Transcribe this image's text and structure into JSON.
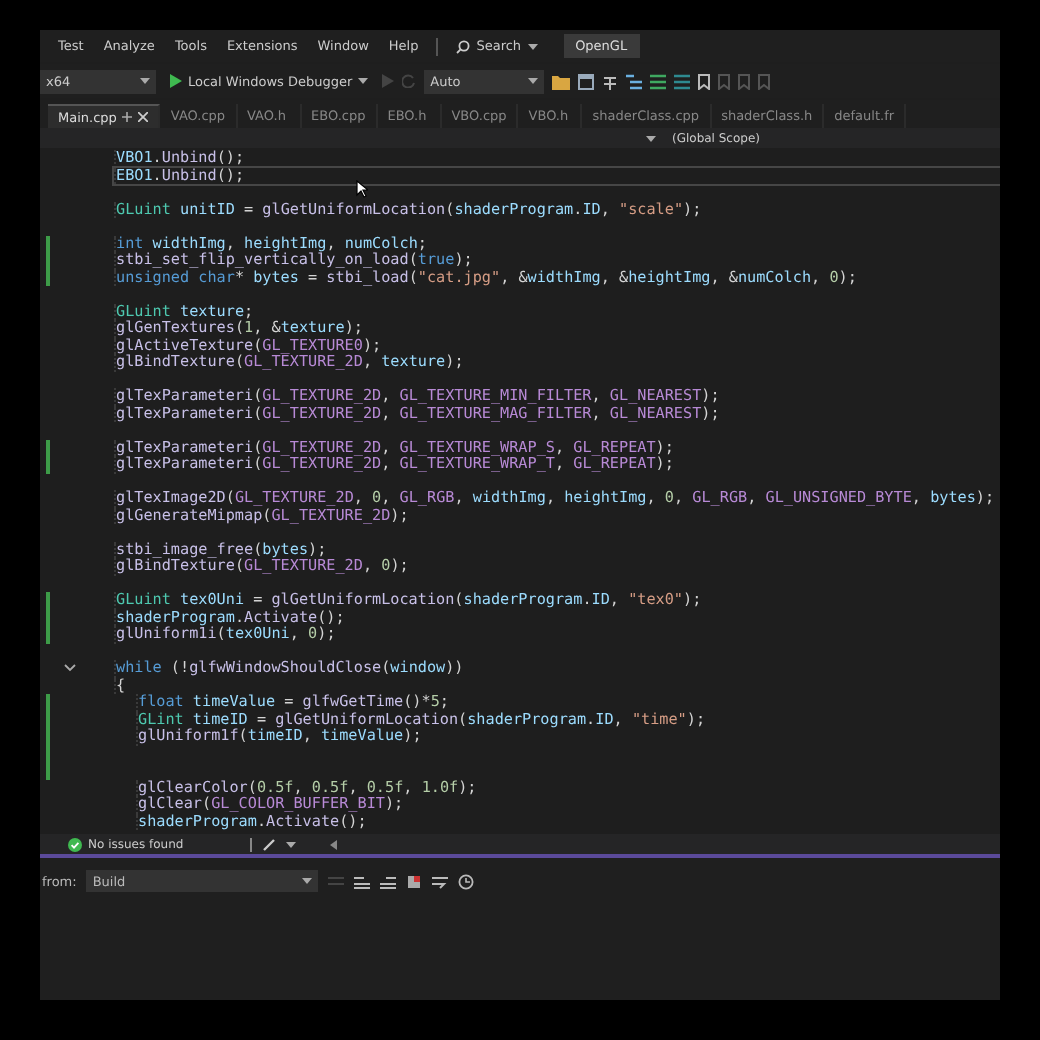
{
  "menu": [
    "Test",
    "Analyze",
    "Tools",
    "Extensions",
    "Window",
    "Help"
  ],
  "search": {
    "label": "Search"
  },
  "solution_title": "OpenGL",
  "toolbar": {
    "platform": "x64",
    "debugger": "Local Windows Debugger",
    "config": "Auto"
  },
  "tabs": [
    {
      "label": "Main.cpp",
      "selected": true
    },
    {
      "label": "VAO.cpp",
      "selected": false
    },
    {
      "label": "VAO.h",
      "selected": false
    },
    {
      "label": "EBO.cpp",
      "selected": false
    },
    {
      "label": "EBO.h",
      "selected": false
    },
    {
      "label": "VBO.cpp",
      "selected": false
    },
    {
      "label": "VBO.h",
      "selected": false
    },
    {
      "label": "shaderClass.cpp",
      "selected": false
    },
    {
      "label": "shaderClass.h",
      "selected": false
    },
    {
      "label": "default.fr",
      "selected": false
    }
  ],
  "scope": "(Global Scope)",
  "code": [
    {
      "changed": false,
      "current": false,
      "foldable": false,
      "tokens": [
        {
          "kind": "var",
          "text": "VBO1"
        },
        {
          "kind": "plain",
          "text": "."
        },
        {
          "kind": "fn",
          "text": "Unbind"
        },
        {
          "kind": "plain",
          "text": "();"
        }
      ]
    },
    {
      "changed": false,
      "current": true,
      "foldable": false,
      "tokens": [
        {
          "kind": "var",
          "text": "EBO1"
        },
        {
          "kind": "plain",
          "text": "."
        },
        {
          "kind": "fn",
          "text": "Unbind"
        },
        {
          "kind": "plain",
          "text": "();"
        }
      ]
    },
    {
      "changed": false,
      "current": false,
      "foldable": false
    },
    {
      "changed": false,
      "current": false,
      "foldable": false,
      "tokens": [
        {
          "kind": "type",
          "text": "GLuint"
        },
        {
          "kind": "var",
          "text": " unitID"
        },
        {
          "kind": "plain",
          "text": " = "
        },
        {
          "kind": "fn",
          "text": "glGetUniformLocation"
        },
        {
          "kind": "plain",
          "text": "("
        },
        {
          "kind": "var",
          "text": "shaderProgram"
        },
        {
          "kind": "plain",
          "text": "."
        },
        {
          "kind": "var",
          "text": "ID"
        },
        {
          "kind": "plain",
          "text": ", "
        },
        {
          "kind": "str",
          "text": "\"scale\""
        },
        {
          "kind": "plain",
          "text": ");"
        }
      ]
    },
    {
      "changed": false,
      "current": false,
      "foldable": false
    },
    {
      "changed": true,
      "current": false,
      "foldable": false,
      "tokens": [
        {
          "kind": "kw",
          "text": "int"
        },
        {
          "kind": "var",
          "text": " widthImg"
        },
        {
          "kind": "plain",
          "text": ", "
        },
        {
          "kind": "var",
          "text": "heightImg"
        },
        {
          "kind": "plain",
          "text": ", "
        },
        {
          "kind": "var",
          "text": "numColch"
        },
        {
          "kind": "plain",
          "text": ";"
        }
      ]
    },
    {
      "changed": true,
      "current": false,
      "foldable": false,
      "tokens": [
        {
          "kind": "fn",
          "text": "stbi_set_flip_vertically_on_load"
        },
        {
          "kind": "plain",
          "text": "("
        },
        {
          "kind": "kw",
          "text": "true"
        },
        {
          "kind": "plain",
          "text": ");"
        }
      ]
    },
    {
      "changed": true,
      "current": false,
      "foldable": false,
      "tokens": [
        {
          "kind": "kw",
          "text": "unsigned char"
        },
        {
          "kind": "plain",
          "text": "* "
        },
        {
          "kind": "var",
          "text": "bytes"
        },
        {
          "kind": "plain",
          "text": " = "
        },
        {
          "kind": "fn",
          "text": "stbi_load"
        },
        {
          "kind": "plain",
          "text": "("
        },
        {
          "kind": "str",
          "text": "\"cat.jpg\""
        },
        {
          "kind": "plain",
          "text": ", &"
        },
        {
          "kind": "var",
          "text": "widthImg"
        },
        {
          "kind": "plain",
          "text": ", &"
        },
        {
          "kind": "var",
          "text": "heightImg"
        },
        {
          "kind": "plain",
          "text": ", &"
        },
        {
          "kind": "var",
          "text": "numColch"
        },
        {
          "kind": "plain",
          "text": ", "
        },
        {
          "kind": "num",
          "text": "0"
        },
        {
          "kind": "plain",
          "text": ");"
        }
      ]
    },
    {
      "changed": false,
      "current": false,
      "foldable": false
    },
    {
      "changed": false,
      "current": false,
      "foldable": false,
      "tokens": [
        {
          "kind": "type",
          "text": "GLuint"
        },
        {
          "kind": "var",
          "text": " texture"
        },
        {
          "kind": "plain",
          "text": ";"
        }
      ]
    },
    {
      "changed": false,
      "current": false,
      "foldable": false,
      "tokens": [
        {
          "kind": "fn",
          "text": "glGenTextures"
        },
        {
          "kind": "plain",
          "text": "("
        },
        {
          "kind": "num",
          "text": "1"
        },
        {
          "kind": "plain",
          "text": ", &"
        },
        {
          "kind": "var",
          "text": "texture"
        },
        {
          "kind": "plain",
          "text": ");"
        }
      ]
    },
    {
      "changed": false,
      "current": false,
      "foldable": false,
      "tokens": [
        {
          "kind": "fn",
          "text": "glActiveTexture"
        },
        {
          "kind": "plain",
          "text": "("
        },
        {
          "kind": "macro",
          "text": "GL_TEXTURE0"
        },
        {
          "kind": "plain",
          "text": ");"
        }
      ]
    },
    {
      "changed": false,
      "current": false,
      "foldable": false,
      "tokens": [
        {
          "kind": "fn",
          "text": "glBindTexture"
        },
        {
          "kind": "plain",
          "text": "("
        },
        {
          "kind": "macro",
          "text": "GL_TEXTURE_2D"
        },
        {
          "kind": "plain",
          "text": ", "
        },
        {
          "kind": "var",
          "text": "texture"
        },
        {
          "kind": "plain",
          "text": ");"
        }
      ]
    },
    {
      "changed": false,
      "current": false,
      "foldable": false
    },
    {
      "changed": false,
      "current": false,
      "foldable": false,
      "tokens": [
        {
          "kind": "fn",
          "text": "glTexParameteri"
        },
        {
          "kind": "plain",
          "text": "("
        },
        {
          "kind": "macro",
          "text": "GL_TEXTURE_2D"
        },
        {
          "kind": "plain",
          "text": ", "
        },
        {
          "kind": "macro",
          "text": "GL_TEXTURE_MIN_FILTER"
        },
        {
          "kind": "plain",
          "text": ", "
        },
        {
          "kind": "macro",
          "text": "GL_NEAREST"
        },
        {
          "kind": "plain",
          "text": ");"
        }
      ]
    },
    {
      "changed": false,
      "current": false,
      "foldable": false,
      "tokens": [
        {
          "kind": "fn",
          "text": "glTexParameteri"
        },
        {
          "kind": "plain",
          "text": "("
        },
        {
          "kind": "macro",
          "text": "GL_TEXTURE_2D"
        },
        {
          "kind": "plain",
          "text": ", "
        },
        {
          "kind": "macro",
          "text": "GL_TEXTURE_MAG_FILTER"
        },
        {
          "kind": "plain",
          "text": ", "
        },
        {
          "kind": "macro",
          "text": "GL_NEAREST"
        },
        {
          "kind": "plain",
          "text": ");"
        }
      ]
    },
    {
      "changed": false,
      "current": false,
      "foldable": false
    },
    {
      "changed": true,
      "current": false,
      "foldable": false,
      "tokens": [
        {
          "kind": "fn",
          "text": "glTexParameteri"
        },
        {
          "kind": "plain",
          "text": "("
        },
        {
          "kind": "macro",
          "text": "GL_TEXTURE_2D"
        },
        {
          "kind": "plain",
          "text": ", "
        },
        {
          "kind": "macro",
          "text": "GL_TEXTURE_WRAP_S"
        },
        {
          "kind": "plain",
          "text": ", "
        },
        {
          "kind": "macro",
          "text": "GL_REPEAT"
        },
        {
          "kind": "plain",
          "text": ");"
        }
      ]
    },
    {
      "changed": true,
      "current": false,
      "foldable": false,
      "tokens": [
        {
          "kind": "fn",
          "text": "glTexParameteri"
        },
        {
          "kind": "plain",
          "text": "("
        },
        {
          "kind": "macro",
          "text": "GL_TEXTURE_2D"
        },
        {
          "kind": "plain",
          "text": ", "
        },
        {
          "kind": "macro",
          "text": "GL_TEXTURE_WRAP_T"
        },
        {
          "kind": "plain",
          "text": ", "
        },
        {
          "kind": "macro",
          "text": "GL_REPEAT"
        },
        {
          "kind": "plain",
          "text": ");"
        }
      ]
    },
    {
      "changed": false,
      "current": false,
      "foldable": false
    },
    {
      "changed": false,
      "current": false,
      "foldable": false,
      "tokens": [
        {
          "kind": "fn",
          "text": "glTexImage2D"
        },
        {
          "kind": "plain",
          "text": "("
        },
        {
          "kind": "macro",
          "text": "GL_TEXTURE_2D"
        },
        {
          "kind": "plain",
          "text": ", "
        },
        {
          "kind": "num",
          "text": "0"
        },
        {
          "kind": "plain",
          "text": ", "
        },
        {
          "kind": "macro",
          "text": "GL_RGB"
        },
        {
          "kind": "plain",
          "text": ", "
        },
        {
          "kind": "var",
          "text": "widthImg"
        },
        {
          "kind": "plain",
          "text": ", "
        },
        {
          "kind": "var",
          "text": "heightImg"
        },
        {
          "kind": "plain",
          "text": ", "
        },
        {
          "kind": "num",
          "text": "0"
        },
        {
          "kind": "plain",
          "text": ", "
        },
        {
          "kind": "macro",
          "text": "GL_RGB"
        },
        {
          "kind": "plain",
          "text": ", "
        },
        {
          "kind": "macro",
          "text": "GL_UNSIGNED_BYTE"
        },
        {
          "kind": "plain",
          "text": ", "
        },
        {
          "kind": "var",
          "text": "bytes"
        },
        {
          "kind": "plain",
          "text": ");"
        }
      ]
    },
    {
      "changed": false,
      "current": false,
      "foldable": false,
      "tokens": [
        {
          "kind": "fn",
          "text": "glGenerateMipmap"
        },
        {
          "kind": "plain",
          "text": "("
        },
        {
          "kind": "macro",
          "text": "GL_TEXTURE_2D"
        },
        {
          "kind": "plain",
          "text": ");"
        }
      ]
    },
    {
      "changed": false,
      "current": false,
      "foldable": false
    },
    {
      "changed": false,
      "current": false,
      "foldable": false,
      "tokens": [
        {
          "kind": "fn",
          "text": "stbi_image_free"
        },
        {
          "kind": "plain",
          "text": "("
        },
        {
          "kind": "var",
          "text": "bytes"
        },
        {
          "kind": "plain",
          "text": ");"
        }
      ]
    },
    {
      "changed": false,
      "current": false,
      "foldable": false,
      "tokens": [
        {
          "kind": "fn",
          "text": "glBindTexture"
        },
        {
          "kind": "plain",
          "text": "("
        },
        {
          "kind": "macro",
          "text": "GL_TEXTURE_2D"
        },
        {
          "kind": "plain",
          "text": ", "
        },
        {
          "kind": "num",
          "text": "0"
        },
        {
          "kind": "plain",
          "text": ");"
        }
      ]
    },
    {
      "changed": false,
      "current": false,
      "foldable": false
    },
    {
      "changed": true,
      "current": false,
      "foldable": false,
      "tokens": [
        {
          "kind": "type",
          "text": "GLuint"
        },
        {
          "kind": "var",
          "text": " tex0Uni"
        },
        {
          "kind": "plain",
          "text": " = "
        },
        {
          "kind": "fn",
          "text": "glGetUniformLocation"
        },
        {
          "kind": "plain",
          "text": "("
        },
        {
          "kind": "var",
          "text": "shaderProgram"
        },
        {
          "kind": "plain",
          "text": "."
        },
        {
          "kind": "var",
          "text": "ID"
        },
        {
          "kind": "plain",
          "text": ", "
        },
        {
          "kind": "str",
          "text": "\"tex0\""
        },
        {
          "kind": "plain",
          "text": ");"
        }
      ]
    },
    {
      "changed": true,
      "current": false,
      "foldable": false,
      "tokens": [
        {
          "kind": "var",
          "text": "shaderProgram"
        },
        {
          "kind": "plain",
          "text": "."
        },
        {
          "kind": "fn",
          "text": "Activate"
        },
        {
          "kind": "plain",
          "text": "();"
        }
      ]
    },
    {
      "changed": true,
      "current": false,
      "foldable": false,
      "tokens": [
        {
          "kind": "fn",
          "text": "glUniform1i"
        },
        {
          "kind": "plain",
          "text": "("
        },
        {
          "kind": "var",
          "text": "tex0Uni"
        },
        {
          "kind": "plain",
          "text": ", "
        },
        {
          "kind": "num",
          "text": "0"
        },
        {
          "kind": "plain",
          "text": ");"
        }
      ]
    },
    {
      "changed": false,
      "current": false,
      "foldable": false
    },
    {
      "changed": false,
      "current": false,
      "foldable": true,
      "tokens": [
        {
          "kind": "kw",
          "text": "while"
        },
        {
          "kind": "plain",
          "text": " (!"
        },
        {
          "kind": "fn",
          "text": "glfwWindowShouldClose"
        },
        {
          "kind": "plain",
          "text": "("
        },
        {
          "kind": "var",
          "text": "window"
        },
        {
          "kind": "plain",
          "text": "))"
        }
      ]
    },
    {
      "changed": false,
      "current": false,
      "foldable": false,
      "tokens": [
        {
          "kind": "plain",
          "text": "{"
        }
      ],
      "children": [
        {
          "changed": true,
          "current": false,
          "foldable": false,
          "tokens": [
            {
              "kind": "kw",
              "text": "float"
            },
            {
              "kind": "var",
              "text": " timeValue"
            },
            {
              "kind": "plain",
              "text": " = "
            },
            {
              "kind": "fn",
              "text": "glfwGetTime"
            },
            {
              "kind": "plain",
              "text": "()*"
            },
            {
              "kind": "num",
              "text": "5"
            },
            {
              "kind": "plain",
              "text": ";"
            }
          ]
        },
        {
          "changed": true,
          "current": false,
          "foldable": false,
          "tokens": [
            {
              "kind": "type",
              "text": "GLint"
            },
            {
              "kind": "var",
              "text": " timeID"
            },
            {
              "kind": "plain",
              "text": " = "
            },
            {
              "kind": "fn",
              "text": "glGetUniformLocation"
            },
            {
              "kind": "plain",
              "text": "("
            },
            {
              "kind": "var",
              "text": "shaderProgram"
            },
            {
              "kind": "plain",
              "text": "."
            },
            {
              "kind": "var",
              "text": "ID"
            },
            {
              "kind": "plain",
              "text": ", "
            },
            {
              "kind": "str",
              "text": "\"time\""
            },
            {
              "kind": "plain",
              "text": ");"
            }
          ]
        },
        {
          "changed": true,
          "current": false,
          "foldable": false,
          "tokens": [
            {
              "kind": "fn",
              "text": "glUniform1f"
            },
            {
              "kind": "plain",
              "text": "("
            },
            {
              "kind": "var",
              "text": "timeID"
            },
            {
              "kind": "plain",
              "text": ", "
            },
            {
              "kind": "var",
              "text": "timeValue"
            },
            {
              "kind": "plain",
              "text": ");"
            }
          ]
        },
        {
          "changed": true,
          "current": false,
          "foldable": false
        },
        {
          "changed": true,
          "current": false,
          "foldable": false
        },
        {
          "changed": false,
          "current": false,
          "foldable": false,
          "tokens": [
            {
              "kind": "fn",
              "text": "glClearColor"
            },
            {
              "kind": "plain",
              "text": "("
            },
            {
              "kind": "num",
              "text": "0.5f"
            },
            {
              "kind": "plain",
              "text": ", "
            },
            {
              "kind": "num",
              "text": "0.5f"
            },
            {
              "kind": "plain",
              "text": ", "
            },
            {
              "kind": "num",
              "text": "0.5f"
            },
            {
              "kind": "plain",
              "text": ", "
            },
            {
              "kind": "num",
              "text": "1.0f"
            },
            {
              "kind": "plain",
              "text": ");"
            }
          ]
        },
        {
          "changed": false,
          "current": false,
          "foldable": false,
          "tokens": [
            {
              "kind": "fn",
              "text": "glClear"
            },
            {
              "kind": "plain",
              "text": "("
            },
            {
              "kind": "macro",
              "text": "GL_COLOR_BUFFER_BIT"
            },
            {
              "kind": "plain",
              "text": ");"
            }
          ]
        },
        {
          "changed": false,
          "current": false,
          "foldable": false,
          "tokens": [
            {
              "kind": "var",
              "text": "shaderProgram"
            },
            {
              "kind": "plain",
              "text": "."
            },
            {
              "kind": "fn",
              "text": "Activate"
            },
            {
              "kind": "plain",
              "text": "();"
            }
          ]
        }
      ]
    }
  ],
  "status": {
    "message": "No issues found"
  },
  "output": {
    "label": "from:",
    "source": "Build"
  }
}
